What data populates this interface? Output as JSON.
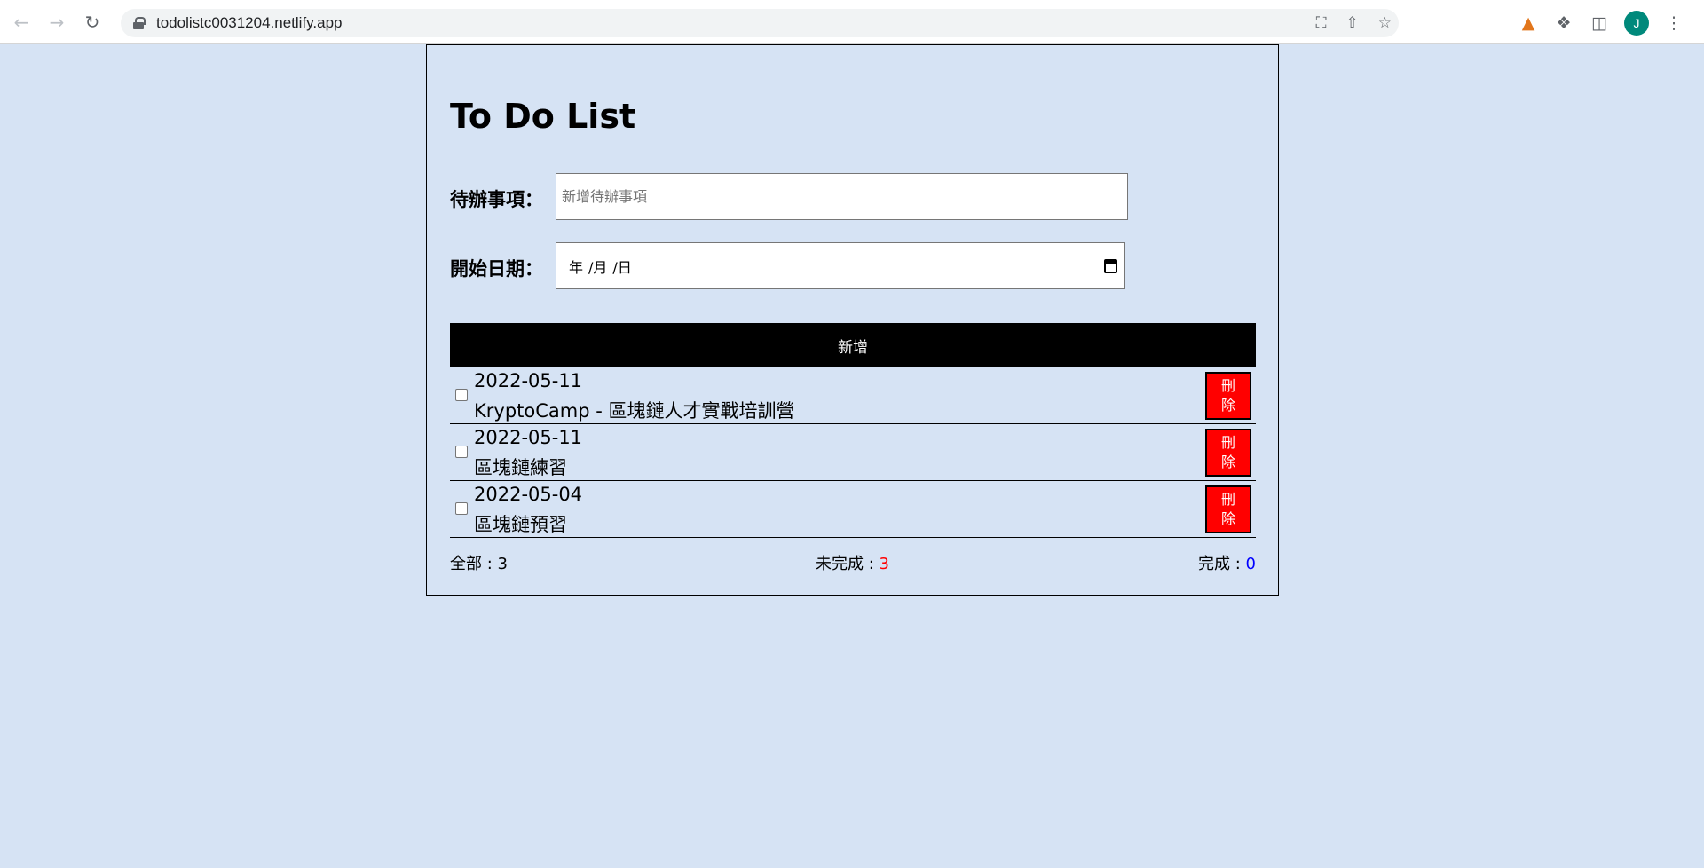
{
  "browser": {
    "url": "todolistc0031204.netlify.app",
    "avatar_initial": "J"
  },
  "page": {
    "title": "To Do List",
    "todo_label": "待辦事項：",
    "todo_placeholder": "新增待辦事項",
    "date_label": "開始日期：",
    "date_year": "年",
    "date_month": "/月",
    "date_day": "/日",
    "add_button": "新增"
  },
  "todos": [
    {
      "date": "2022-05-11",
      "text": "KryptoCamp - 區塊鏈人才實戰培訓營",
      "checked": false,
      "delete_label": "刪除"
    },
    {
      "date": "2022-05-11",
      "text": "區塊鏈練習",
      "checked": false,
      "delete_label": "刪除"
    },
    {
      "date": "2022-05-04",
      "text": "區塊鏈預習",
      "checked": false,
      "delete_label": "刪除"
    }
  ],
  "stats": {
    "all_label": "全部 : ",
    "all_value": "3",
    "incomplete_label": "未完成 : ",
    "incomplete_value": "3",
    "complete_label": "完成 : ",
    "complete_value": "0"
  },
  "colors": {
    "background": "#d6e3f4",
    "delete_button": "#ff0000",
    "incomplete_value": "#ff0000",
    "complete_value": "#0000ff"
  }
}
